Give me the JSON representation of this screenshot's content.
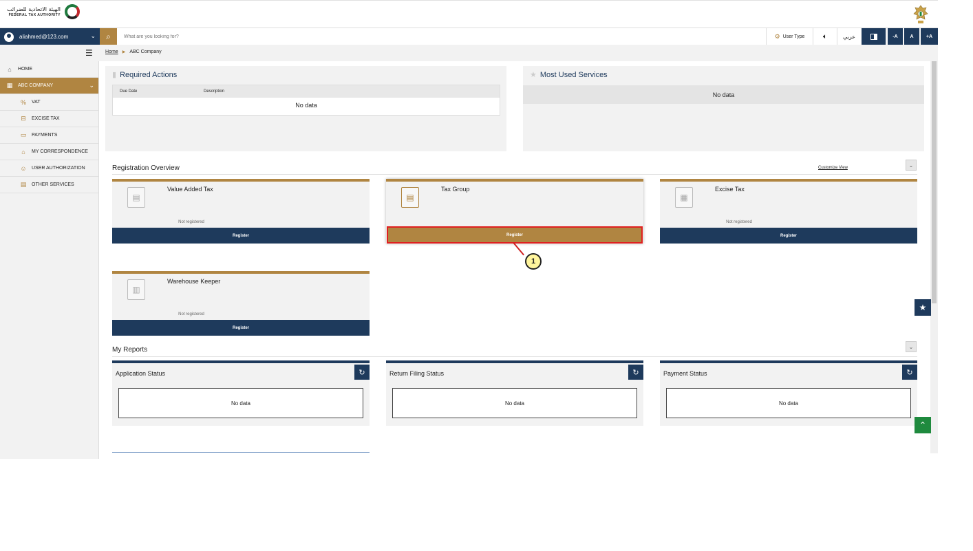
{
  "header": {
    "logo_arabic": "الهيئة الاتحادية للضرائب",
    "logo_english": "FEDERAL TAX AUTHORITY"
  },
  "navbar": {
    "user_email": "aliahmed@123.com",
    "search_placeholder": "What are you looking for?",
    "user_type": "User Type",
    "arabic": "عربي",
    "font_decrease": "-A",
    "font_normal": "A",
    "font_increase": "+A"
  },
  "breadcrumb": {
    "home": "Home",
    "current": "ABC Company"
  },
  "sidebar": {
    "items": [
      {
        "label": "HOME"
      },
      {
        "label": "ABC COMPANY"
      },
      {
        "label": "VAT"
      },
      {
        "label": "EXCISE TAX"
      },
      {
        "label": "PAYMENTS"
      },
      {
        "label": "MY CORRESPONDENCE"
      },
      {
        "label": "USER AUTHORIZATION"
      },
      {
        "label": "OTHER SERVICES"
      }
    ]
  },
  "required_actions": {
    "title": "Required Actions",
    "col_due_date": "Due Date",
    "col_description": "Description",
    "empty": "No data"
  },
  "most_used": {
    "title": "Most Used Services",
    "empty": "No data"
  },
  "registration": {
    "title": "Registration Overview",
    "customize": "Customize View",
    "cards": [
      {
        "title": "Value Added Tax",
        "status": "Not registered",
        "button": "Register"
      },
      {
        "title": "Tax Group",
        "status": "",
        "button": "Register"
      },
      {
        "title": "Excise Tax",
        "status": "Not registered",
        "button": "Register"
      },
      {
        "title": "Warehouse Keeper",
        "status": "Not registered",
        "button": "Register"
      }
    ]
  },
  "callout": {
    "number": "1"
  },
  "reports": {
    "title": "My Reports",
    "cards": [
      {
        "title": "Application Status",
        "empty": "No data"
      },
      {
        "title": "Return Filing Status",
        "empty": "No data"
      },
      {
        "title": "Payment Status",
        "empty": "No data"
      }
    ]
  },
  "colors": {
    "navy": "#1e3a5c",
    "gold": "#b08541",
    "highlight": "#e02020",
    "float_green": "#1f8a3e"
  }
}
